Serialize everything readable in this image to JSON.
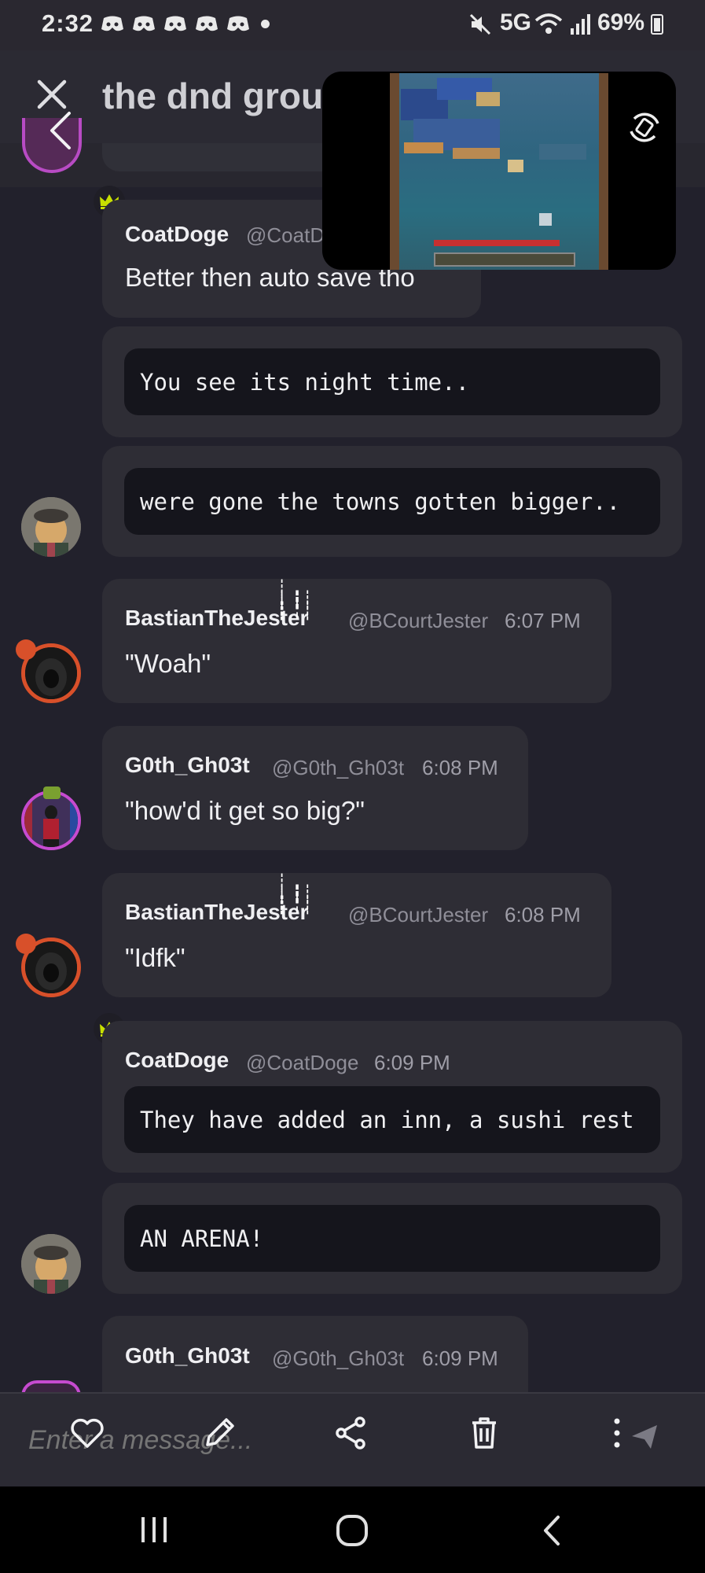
{
  "status_bar": {
    "time": "2:32",
    "indicators": "5G",
    "battery": "69%"
  },
  "header": {
    "title": "the dnd group"
  },
  "messages": [
    {
      "author": "CoatDoge",
      "handle": "@CoatD",
      "text": "Better then auto save tho"
    },
    {
      "code": "You see its night time.."
    },
    {
      "code": " were gone the towns gotten bigger.."
    },
    {
      "author": "BastianTheJester",
      "handle": "@BCourtJester",
      "time": "6:07 PM",
      "text": "\"Woah\""
    },
    {
      "author": "G0th_Gh03t",
      "handle": "@G0th_Gh03t",
      "time": "6:08 PM",
      "text": "\"how'd it get so big?\""
    },
    {
      "author": "BastianTheJester",
      "handle": "@BCourtJester",
      "time": "6:08 PM",
      "text": "\"Idfk\""
    },
    {
      "author": "CoatDoge",
      "handle": "@CoatDoge",
      "time": "6:09 PM",
      "code": "They have added an inn, a sushi rest"
    },
    {
      "code": "AN ARENA!"
    },
    {
      "author": "G0th_Gh03t",
      "handle": "@G0th_Gh03t",
      "time": "6:09 PM"
    }
  ],
  "composer": {
    "placeholder": "Enter a message..."
  },
  "icons": {
    "close": "close-icon",
    "back": "back-icon",
    "heart": "heart-icon",
    "edit": "pencil-icon",
    "share": "share-icon",
    "delete": "trash-icon",
    "more": "more-vertical-icon",
    "send": "send-icon"
  },
  "colors": {
    "background": "#22212c",
    "bubble": "#2e2d35",
    "code_block": "#15151c",
    "crown": "#c8e000"
  }
}
